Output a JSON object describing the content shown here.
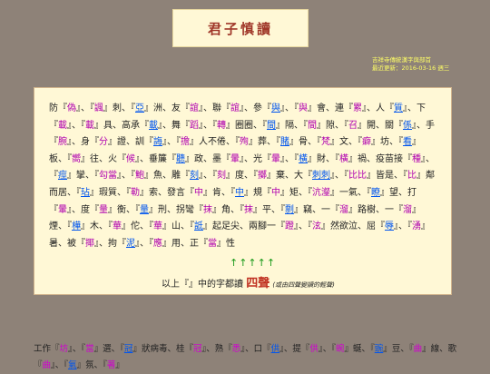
{
  "title": "君子慎讀",
  "meta": {
    "line1": "吉祥寺傳統漢字與部首",
    "line2": "最近更新：2016-03-16 週三"
  },
  "main_paragraph": "防『偽』、『諷』刺、『亞』洲、友『誼』、聯『誼』、參『與』、『與』會、連『累』、人『質』、下『載』、『載』具、高承『載』、舞『蹈』、『轉』圈圈、『間』隔、『間』隙、『召』開、關『係』、手『腕』、身『分』證、訓『誨』、『擔』人不倦、『殉』葬、『賭』骨、『梵』文、『癖』坊、『看』板、『嚮』往、火『候』、垂簾『聽』政、墨『暈』、光『暈』、『橫』財、『橫』禍、疫苗接『種』、『痙』攣、『勾當』、『鮑』魚、雕『刻』、『刻』度、『擲』棄、大『刺刺』、『比比』皆是、『比』鄰而居、『玷』瑕質、『勒』索、發言『中』肯、『中』規『中』矩、『沆瀣』一氣、『瞭』望、打『暈』、度『量』衡、『量』刑、拐彎『抹』角、『抹』平、『剽』竊、一『溜』路樹、一『溜』煙、『樺』木、『華』佗、『華』山、『詆』起足尖、兩腳一『蹬』、『泫』然欲泣、屈『辱』、『湧』暑、被『揶』、拘『泥』、『應』用、正『當』性",
  "arrows": "↑↑↑↑↑",
  "summary": {
    "prefix": "以上『』中的字都讀",
    "tone": "四聲",
    "note": "(或由四聲變讀的輕聲)"
  },
  "bottom_paragraph": "工作『坊』、『當』選、『冠』狀病毒、桂『冠』、熟『悉』、口『供』、提『供』、『蜿』蜒、『豌』豆、『曲』線、歌『曲』、『氣』氛、『著』"
}
